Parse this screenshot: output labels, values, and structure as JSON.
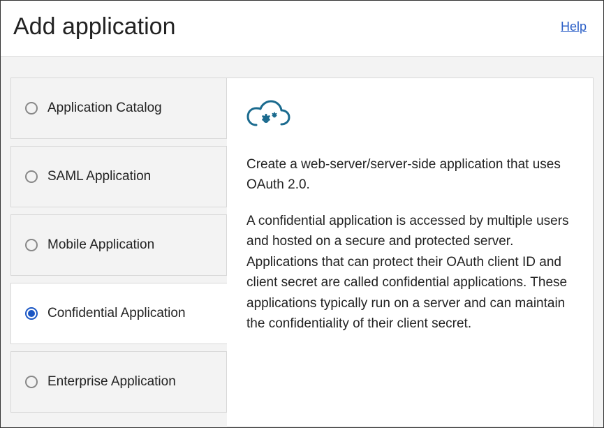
{
  "header": {
    "title": "Add application",
    "help_label": "Help"
  },
  "sidebar": {
    "items": [
      {
        "label": "Application Catalog",
        "selected": false
      },
      {
        "label": "SAML Application",
        "selected": false
      },
      {
        "label": "Mobile Application",
        "selected": false
      },
      {
        "label": "Confidential Application",
        "selected": true
      },
      {
        "label": "Enterprise Application",
        "selected": false
      }
    ]
  },
  "detail": {
    "intro": "Create a web-server/server-side application that uses OAuth 2.0.",
    "description": "A confidential application is accessed by multiple users and hosted on a secure and protected server. Applications that can protect their OAuth client ID and client secret are called confidential applications. These applications typically run on a server and can maintain the confidentiality of their client secret."
  }
}
